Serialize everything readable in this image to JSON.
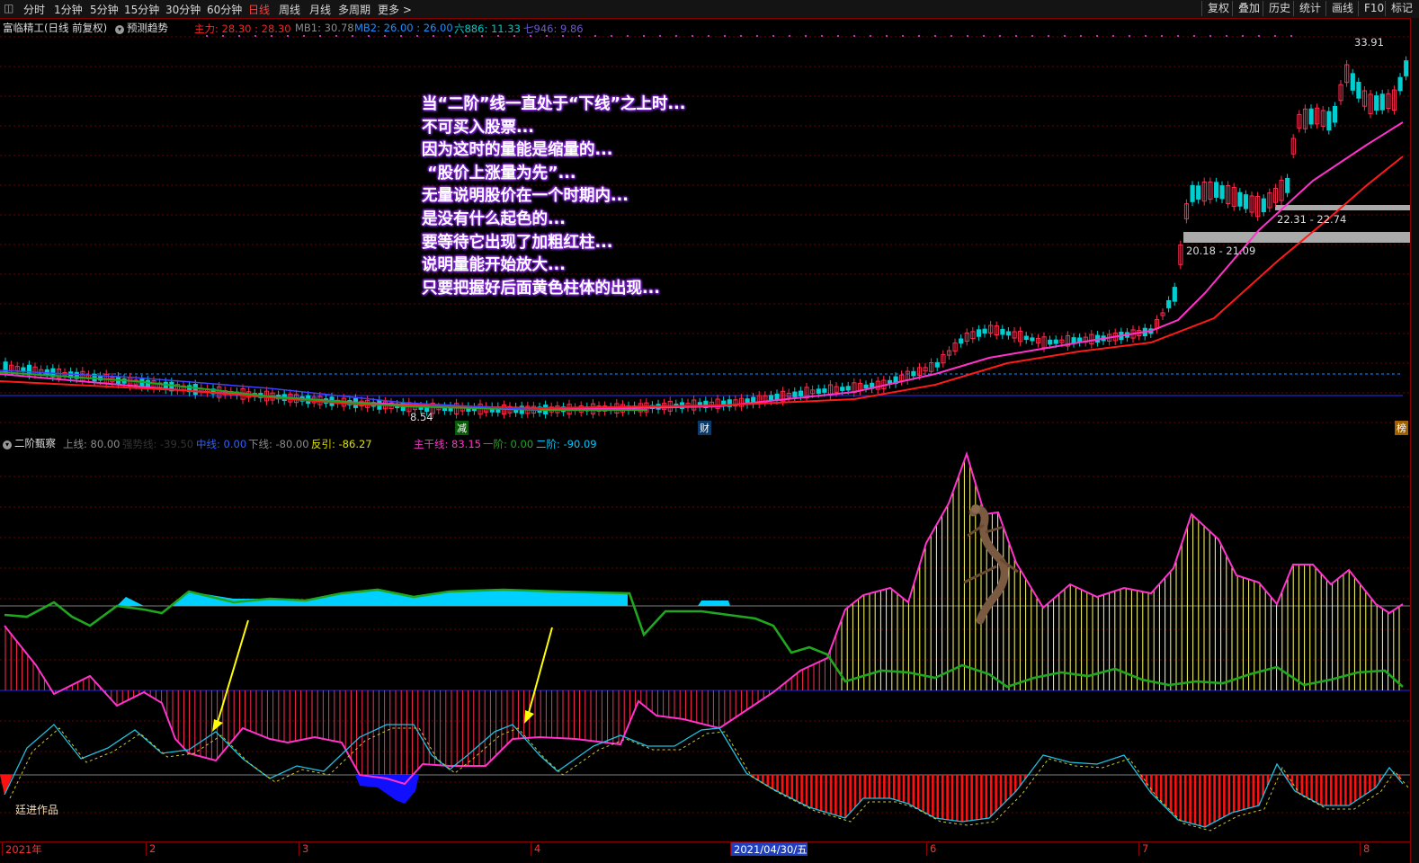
{
  "toolbar": {
    "periods": [
      "分时",
      "1分钟",
      "5分钟",
      "15分钟",
      "30分钟",
      "60分钟",
      "日线",
      "周线",
      "月线",
      "多周期",
      "更多 >"
    ],
    "active_period": "日线",
    "right_buttons": [
      "复权",
      "叠加",
      "历史",
      "统计",
      "画线",
      "F10",
      "标记"
    ]
  },
  "main_header": {
    "stock": "富临精工(日线 前复权)",
    "toggle": "预测趋势",
    "zhuli": "主力: 28.30 : 28.30",
    "mb1": "MB1: 30.78",
    "mb2": "MB2: 26.00 : 26.00",
    "ma886": "六886: 11.33",
    "ma946": "七946: 9.86"
  },
  "price_labels": {
    "high": "33.91",
    "low": "8.54",
    "zone1": "22.31 - 22.74",
    "zone2": "20.18 - 21.09"
  },
  "event_markers": {
    "reduce": "减",
    "finance": "财",
    "list": "榜"
  },
  "annotation_lines": [
    "当“二阶”线一直处于“下线”之上时...",
    "不可买入股票...",
    "因为这时的量能是缩量的...",
    " “股价上涨量为先”...",
    "无量说明股价在一个时期内...",
    "是没有什么起色的...",
    "要等待它出现了加粗红柱...",
    "说明量能开始放大...",
    "只要把握好后面黄色柱体的出现..."
  ],
  "sub_header": {
    "name": "二阶甄察",
    "upper": "上线: 80.00",
    "strong": "强势线: -39.50",
    "mid": "中线: 0.00",
    "lower": "下线: -80.00",
    "rebound": "反引: -86.27",
    "main": "主干线: 83.15",
    "first": "一阶: 0.00",
    "second": "二阶: -90.09"
  },
  "author": "廷进作品",
  "time_axis": [
    "2021年",
    "2",
    "3",
    "4",
    "2021/04/30/五",
    "6",
    "7",
    "8"
  ],
  "colors": {
    "up": "#ff2b4f",
    "down": "#00ced1",
    "ma_pink": "#ff33cc",
    "ma_red": "#ff1a1a",
    "green_line": "#1fa81f",
    "blue_fill": "#1010ff",
    "cyan_fill": "#00d0ff",
    "yellow": "#ffff66"
  }
}
